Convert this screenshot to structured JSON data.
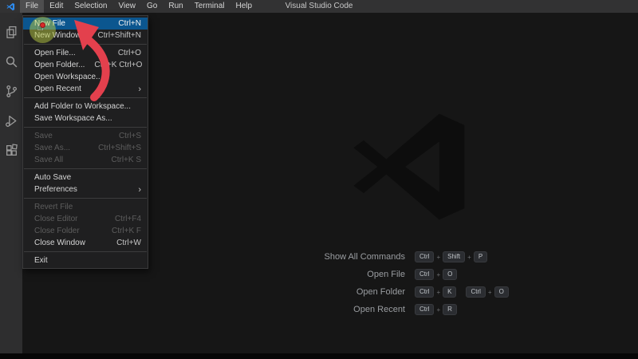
{
  "title_bar": {
    "title": "Visual Studio Code",
    "menus": [
      "File",
      "Edit",
      "Selection",
      "View",
      "Go",
      "Run",
      "Terminal",
      "Help"
    ],
    "active_menu": "File"
  },
  "activity_bar": {
    "items": [
      "explorer",
      "search",
      "source-control",
      "run-and-debug",
      "extensions"
    ]
  },
  "file_menu": {
    "sections": [
      {
        "items": [
          {
            "label": "New File",
            "shortcut": "Ctrl+N",
            "highlighted": true
          },
          {
            "label": "New Window",
            "shortcut": "Ctrl+Shift+N"
          }
        ]
      },
      {
        "items": [
          {
            "label": "Open File...",
            "shortcut": "Ctrl+O"
          },
          {
            "label": "Open Folder...",
            "shortcut": "Ctrl+K Ctrl+O"
          },
          {
            "label": "Open Workspace..."
          },
          {
            "label": "Open Recent",
            "submenu": true
          }
        ]
      },
      {
        "items": [
          {
            "label": "Add Folder to Workspace..."
          },
          {
            "label": "Save Workspace As..."
          }
        ]
      },
      {
        "items": [
          {
            "label": "Save",
            "shortcut": "Ctrl+S",
            "disabled": true
          },
          {
            "label": "Save As...",
            "shortcut": "Ctrl+Shift+S",
            "disabled": true
          },
          {
            "label": "Save All",
            "shortcut": "Ctrl+K S",
            "disabled": true
          }
        ]
      },
      {
        "items": [
          {
            "label": "Auto Save"
          },
          {
            "label": "Preferences",
            "submenu": true
          }
        ]
      },
      {
        "items": [
          {
            "label": "Revert File",
            "disabled": true
          },
          {
            "label": "Close Editor",
            "shortcut": "Ctrl+F4",
            "disabled": true
          },
          {
            "label": "Close Folder",
            "shortcut": "Ctrl+K F",
            "disabled": true
          },
          {
            "label": "Close Window",
            "shortcut": "Ctrl+W"
          }
        ]
      },
      {
        "items": [
          {
            "label": "Exit"
          }
        ]
      }
    ]
  },
  "welcome_shortcuts": [
    {
      "label": "Show All Commands",
      "groups": [
        [
          "Ctrl",
          "Shift",
          "P"
        ]
      ]
    },
    {
      "label": "Open File",
      "groups": [
        [
          "Ctrl",
          "O"
        ]
      ]
    },
    {
      "label": "Open Folder",
      "groups": [
        [
          "Ctrl",
          "K"
        ],
        [
          "Ctrl",
          "O"
        ]
      ]
    },
    {
      "label": "Open Recent",
      "groups": [
        [
          "Ctrl",
          "R"
        ]
      ]
    }
  ],
  "colors": {
    "editor_bg": "#161616",
    "menu_highlight": "#0b568f",
    "annotation_red": "#e3404d",
    "click_indicator": "#bacc42",
    "logo_blue": "#2d8cf0"
  }
}
